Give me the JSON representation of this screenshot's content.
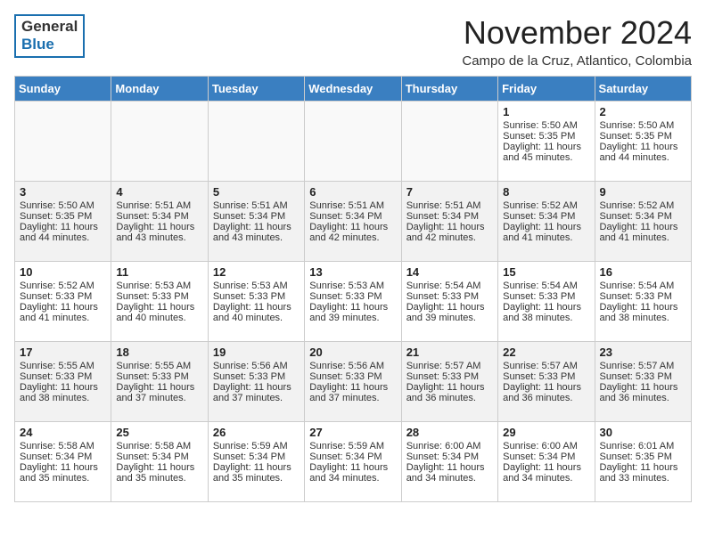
{
  "header": {
    "logo_general": "General",
    "logo_blue": "Blue",
    "month": "November 2024",
    "location": "Campo de la Cruz, Atlantico, Colombia"
  },
  "days_of_week": [
    "Sunday",
    "Monday",
    "Tuesday",
    "Wednesday",
    "Thursday",
    "Friday",
    "Saturday"
  ],
  "weeks": [
    [
      {
        "day": "",
        "content": ""
      },
      {
        "day": "",
        "content": ""
      },
      {
        "day": "",
        "content": ""
      },
      {
        "day": "",
        "content": ""
      },
      {
        "day": "",
        "content": ""
      },
      {
        "day": "1",
        "content": "Sunrise: 5:50 AM\nSunset: 5:35 PM\nDaylight: 11 hours and 45 minutes."
      },
      {
        "day": "2",
        "content": "Sunrise: 5:50 AM\nSunset: 5:35 PM\nDaylight: 11 hours and 44 minutes."
      }
    ],
    [
      {
        "day": "3",
        "content": "Sunrise: 5:50 AM\nSunset: 5:35 PM\nDaylight: 11 hours and 44 minutes."
      },
      {
        "day": "4",
        "content": "Sunrise: 5:51 AM\nSunset: 5:34 PM\nDaylight: 11 hours and 43 minutes."
      },
      {
        "day": "5",
        "content": "Sunrise: 5:51 AM\nSunset: 5:34 PM\nDaylight: 11 hours and 43 minutes."
      },
      {
        "day": "6",
        "content": "Sunrise: 5:51 AM\nSunset: 5:34 PM\nDaylight: 11 hours and 42 minutes."
      },
      {
        "day": "7",
        "content": "Sunrise: 5:51 AM\nSunset: 5:34 PM\nDaylight: 11 hours and 42 minutes."
      },
      {
        "day": "8",
        "content": "Sunrise: 5:52 AM\nSunset: 5:34 PM\nDaylight: 11 hours and 41 minutes."
      },
      {
        "day": "9",
        "content": "Sunrise: 5:52 AM\nSunset: 5:34 PM\nDaylight: 11 hours and 41 minutes."
      }
    ],
    [
      {
        "day": "10",
        "content": "Sunrise: 5:52 AM\nSunset: 5:33 PM\nDaylight: 11 hours and 41 minutes."
      },
      {
        "day": "11",
        "content": "Sunrise: 5:53 AM\nSunset: 5:33 PM\nDaylight: 11 hours and 40 minutes."
      },
      {
        "day": "12",
        "content": "Sunrise: 5:53 AM\nSunset: 5:33 PM\nDaylight: 11 hours and 40 minutes."
      },
      {
        "day": "13",
        "content": "Sunrise: 5:53 AM\nSunset: 5:33 PM\nDaylight: 11 hours and 39 minutes."
      },
      {
        "day": "14",
        "content": "Sunrise: 5:54 AM\nSunset: 5:33 PM\nDaylight: 11 hours and 39 minutes."
      },
      {
        "day": "15",
        "content": "Sunrise: 5:54 AM\nSunset: 5:33 PM\nDaylight: 11 hours and 38 minutes."
      },
      {
        "day": "16",
        "content": "Sunrise: 5:54 AM\nSunset: 5:33 PM\nDaylight: 11 hours and 38 minutes."
      }
    ],
    [
      {
        "day": "17",
        "content": "Sunrise: 5:55 AM\nSunset: 5:33 PM\nDaylight: 11 hours and 38 minutes."
      },
      {
        "day": "18",
        "content": "Sunrise: 5:55 AM\nSunset: 5:33 PM\nDaylight: 11 hours and 37 minutes."
      },
      {
        "day": "19",
        "content": "Sunrise: 5:56 AM\nSunset: 5:33 PM\nDaylight: 11 hours and 37 minutes."
      },
      {
        "day": "20",
        "content": "Sunrise: 5:56 AM\nSunset: 5:33 PM\nDaylight: 11 hours and 37 minutes."
      },
      {
        "day": "21",
        "content": "Sunrise: 5:57 AM\nSunset: 5:33 PM\nDaylight: 11 hours and 36 minutes."
      },
      {
        "day": "22",
        "content": "Sunrise: 5:57 AM\nSunset: 5:33 PM\nDaylight: 11 hours and 36 minutes."
      },
      {
        "day": "23",
        "content": "Sunrise: 5:57 AM\nSunset: 5:33 PM\nDaylight: 11 hours and 36 minutes."
      }
    ],
    [
      {
        "day": "24",
        "content": "Sunrise: 5:58 AM\nSunset: 5:34 PM\nDaylight: 11 hours and 35 minutes."
      },
      {
        "day": "25",
        "content": "Sunrise: 5:58 AM\nSunset: 5:34 PM\nDaylight: 11 hours and 35 minutes."
      },
      {
        "day": "26",
        "content": "Sunrise: 5:59 AM\nSunset: 5:34 PM\nDaylight: 11 hours and 35 minutes."
      },
      {
        "day": "27",
        "content": "Sunrise: 5:59 AM\nSunset: 5:34 PM\nDaylight: 11 hours and 34 minutes."
      },
      {
        "day": "28",
        "content": "Sunrise: 6:00 AM\nSunset: 5:34 PM\nDaylight: 11 hours and 34 minutes."
      },
      {
        "day": "29",
        "content": "Sunrise: 6:00 AM\nSunset: 5:34 PM\nDaylight: 11 hours and 34 minutes."
      },
      {
        "day": "30",
        "content": "Sunrise: 6:01 AM\nSunset: 5:35 PM\nDaylight: 11 hours and 33 minutes."
      }
    ]
  ]
}
